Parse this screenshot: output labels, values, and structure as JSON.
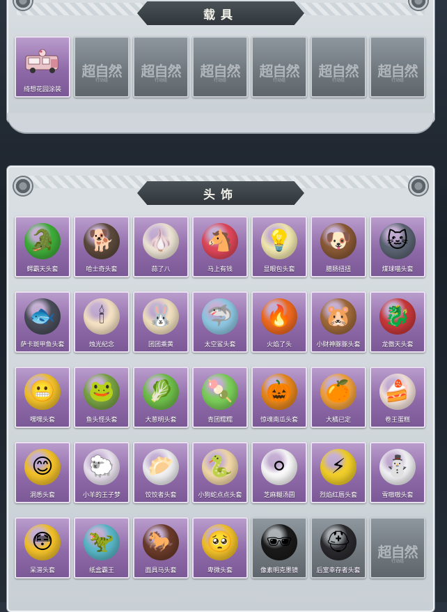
{
  "vehicle_section": {
    "title": "载具",
    "items": [
      {
        "label": "绮想花园涂装",
        "owned": true,
        "icon": "dessert-truck",
        "color": "#e9c3c8"
      },
      {
        "label": "",
        "owned": false,
        "watermark": "超自然",
        "sub": "行动组"
      },
      {
        "label": "",
        "owned": false,
        "watermark": "超自然",
        "sub": "行动组"
      },
      {
        "label": "",
        "owned": false,
        "watermark": "超自然",
        "sub": "行动组"
      },
      {
        "label": "",
        "owned": false,
        "watermark": "超自然",
        "sub": "行动组"
      },
      {
        "label": "",
        "owned": false,
        "watermark": "超自然",
        "sub": "行动组"
      },
      {
        "label": "",
        "owned": false,
        "watermark": "超自然",
        "sub": "行动组"
      }
    ]
  },
  "headwear_section": {
    "title": "头饰",
    "items": [
      {
        "label": "鳄霸天头套",
        "owned": true,
        "glyph": "🐊",
        "color": "#3fae3a"
      },
      {
        "label": "哈士奇头套",
        "owned": true,
        "glyph": "🐕",
        "color": "#5c4a3c"
      },
      {
        "label": "蒜了八",
        "owned": true,
        "glyph": "🧄",
        "color": "#efe6d6"
      },
      {
        "label": "马上有钱",
        "owned": true,
        "glyph": "🐴",
        "color": "#e0475a"
      },
      {
        "label": "显眼包头套",
        "owned": true,
        "glyph": "💡",
        "color": "#f3e9b0"
      },
      {
        "label": "腊肠扭扭",
        "owned": true,
        "glyph": "🐶",
        "color": "#8a5a36"
      },
      {
        "label": "煤球喵头套",
        "owned": true,
        "glyph": "🐱",
        "color": "#5b6473"
      },
      {
        "label": "萨卡斑甲鱼头套",
        "owned": true,
        "glyph": "🐟",
        "color": "#4a4e5a"
      },
      {
        "label": "烛光纪念",
        "owned": true,
        "glyph": "🕯",
        "color": "#f6e2c4"
      },
      {
        "label": "团团乘黄",
        "owned": true,
        "glyph": "🐰",
        "color": "#f2e1c0"
      },
      {
        "label": "太空鲨头套",
        "owned": true,
        "glyph": "🦈",
        "color": "#8fc9e4"
      },
      {
        "label": "火焰了头",
        "owned": true,
        "glyph": "🔥",
        "color": "#f06a1f"
      },
      {
        "label": "小财神豚豚头套",
        "owned": true,
        "glyph": "🐹",
        "color": "#a06a3a"
      },
      {
        "label": "龙傲天头套",
        "owned": true,
        "glyph": "🐉",
        "color": "#c9383a"
      },
      {
        "label": "嘿嘿头套",
        "owned": true,
        "glyph": "😬",
        "color": "#f4c22b"
      },
      {
        "label": "鱼头怪头套",
        "owned": true,
        "glyph": "🐸",
        "color": "#79a345"
      },
      {
        "label": "大葱明头套",
        "owned": true,
        "glyph": "🥬",
        "color": "#6fbf4a"
      },
      {
        "label": "青团糯糯",
        "owned": true,
        "glyph": "🍡",
        "color": "#7ccf5a"
      },
      {
        "label": "惊魂南瓜头套",
        "owned": true,
        "glyph": "🎃",
        "color": "#e8881e"
      },
      {
        "label": "大橘已定",
        "owned": true,
        "glyph": "🍊",
        "color": "#f2a23d"
      },
      {
        "label": "卷王蛋糕",
        "owned": true,
        "glyph": "🍰",
        "color": "#f4e3da"
      },
      {
        "label": "洞悉头套",
        "owned": true,
        "glyph": "😊",
        "color": "#f4c22b"
      },
      {
        "label": "小羊的王子梦",
        "owned": true,
        "glyph": "🐑",
        "color": "#ece4f1"
      },
      {
        "label": "饺饺者头套",
        "owned": true,
        "glyph": "🥟",
        "color": "#f1f1f4"
      },
      {
        "label": "小狗蛇点点头套",
        "owned": true,
        "glyph": "🐍",
        "color": "#f3d9a8"
      },
      {
        "label": "芝麻糊汤圆",
        "owned": true,
        "glyph": "⚪",
        "color": "#fafafa"
      },
      {
        "label": "烈焰红唇头套",
        "owned": true,
        "glyph": "⚡",
        "color": "#f2cf2a"
      },
      {
        "label": "雪嗷嗷头套",
        "owned": true,
        "glyph": "⛄",
        "color": "#f3f3f6"
      },
      {
        "label": "呆滞头套",
        "owned": true,
        "glyph": "😳",
        "color": "#f4c22b"
      },
      {
        "label": "纸盒霸王",
        "owned": true,
        "glyph": "🦖",
        "color": "#5ab8c9"
      },
      {
        "label": "面具马头套",
        "owned": true,
        "glyph": "🐎",
        "color": "#6b3b2a"
      },
      {
        "label": "卑微头套",
        "owned": true,
        "glyph": "🥺",
        "color": "#f4c22b"
      },
      {
        "label": "像素明克墨镜",
        "owned": true,
        "glyph": "🕶",
        "color": "#1a1a1a",
        "locked_style": true
      },
      {
        "label": "后室幸存者头套",
        "owned": true,
        "glyph": "⛑",
        "color": "#2a2a2e",
        "locked_style": true
      },
      {
        "label": "",
        "owned": false,
        "watermark": "超自然",
        "sub": "行动组"
      }
    ]
  }
}
